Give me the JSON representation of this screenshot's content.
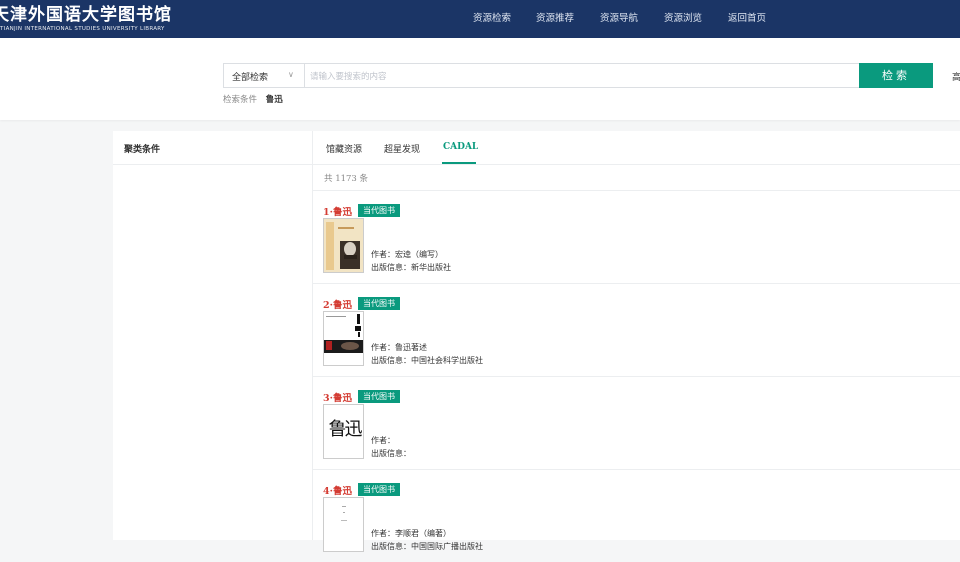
{
  "header": {
    "logo_cn": "天津外国语大学图书馆",
    "logo_en": "TIANJIN INTERNATIONAL STUDIES UNIVERSITY LIBRARY",
    "nav": [
      "资源检索",
      "资源推荐",
      "资源导航",
      "资源浏览",
      "返回首页"
    ]
  },
  "search": {
    "scope": "全部检索",
    "placeholder": "请输入要搜索的内容",
    "button": "检索",
    "advanced": "高",
    "condition_label": "检索条件",
    "condition_value": "鲁迅"
  },
  "facets": {
    "title": "聚类条件"
  },
  "tabs": [
    "馆藏资源",
    "超星发现",
    "CADAL"
  ],
  "active_tab": "CADAL",
  "count_text": "共 1173 条",
  "results": [
    {
      "num": "1",
      "title": "鲁迅",
      "badge": "当代图书",
      "author": "作者：宏逵（编写）",
      "publisher": "出版信息：新华出版社"
    },
    {
      "num": "2",
      "title": "鲁迅",
      "badge": "当代图书",
      "author": "作者：鲁迅著述",
      "publisher": "出版信息：中国社会科学出版社"
    },
    {
      "num": "3",
      "title": "鲁迅",
      "badge": "当代图书",
      "author": "作者：",
      "publisher": "出版信息：",
      "cover_text": "鲁迅"
    },
    {
      "num": "4",
      "title": "鲁迅",
      "badge": "当代图书",
      "author": "作者：李顺君（编著）",
      "publisher": "出版信息：中国国际广播出版社"
    }
  ],
  "colors": {
    "header": "#1b3566",
    "accent": "#0a9a7e",
    "title_red": "#d43c33"
  }
}
